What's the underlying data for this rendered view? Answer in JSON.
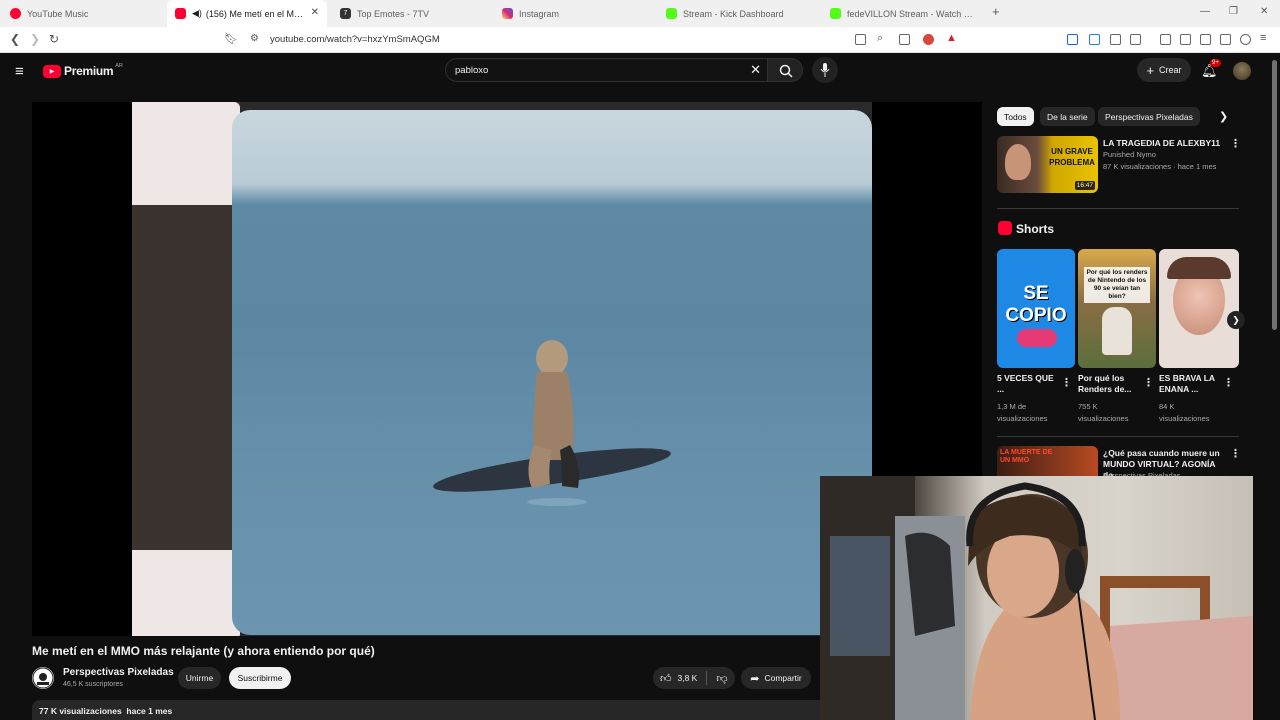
{
  "browser": {
    "tabs": [
      {
        "title": "YouTube Music",
        "color": "#ff0033"
      },
      {
        "title": "(156) Me metí en el MMO más relajante (y ahora entiendo por qué)",
        "color": "#ff0033",
        "active": true
      },
      {
        "title": "Top Emotes - 7TV",
        "color": "#29b6f6"
      },
      {
        "title": "Instagram",
        "color": "#d62976"
      },
      {
        "title": "Stream - Kick Dashboard",
        "color": "#53fc18"
      },
      {
        "title": "fedeVILLON Stream - Watch Live on Kick",
        "color": "#53fc18"
      }
    ],
    "url": "youtube.com/watch?v=hxzYmSmAQGM"
  },
  "header": {
    "logo": "Premium",
    "logo_badge": "AR",
    "search_value": "pabloxo",
    "create_label": "Crear",
    "notif_count": "9+"
  },
  "video": {
    "title": "Me metí en el MMO más relajante (y ahora entiendo por qué)",
    "channel": "Perspectivas Pixeladas",
    "subscribers": "46,5 K suscriptores",
    "join_label": "Unirme",
    "subscribe_label": "Suscribirme",
    "likes": "3,8 K",
    "share_label": "Compartir",
    "stats": "77 K visualizaciones  hace 1 mes"
  },
  "sidebar": {
    "chips": [
      "Todos",
      "De la serie",
      "Perspectivas Pixeladas"
    ],
    "recommended": [
      {
        "title": "LA TRAGEDIA DE ALEXBY11",
        "channel": "Punished Nymo",
        "meta": "87 K visualizaciones · hace 1 mes",
        "duration": "16:47",
        "thumb_text": "UN GRAVE PROBLEMA"
      },
      {
        "title": "¿Qué pasa cuando muere un MUNDO VIRTUAL? AGONÍA de...",
        "channel": "Perspectivas Pixeladas",
        "thumb_text": "LA MUERTE DE UN MMO"
      }
    ],
    "shorts_label": "Shorts",
    "shorts": [
      {
        "title": "5 VECES QUE ...",
        "views": "1,3 M de visualizaciones",
        "thumb_text": "SE COPIO",
        "bg": "#1e88e5"
      },
      {
        "title": "Por qué los Renders de...",
        "views": "755 K visualizaciones",
        "thumb_text": "Por qué los renders de Nintendo de los 90 se veían tan bien?",
        "bg": "#6b5a3a"
      },
      {
        "title": "ES BRAVA LA ENANA ...",
        "views": "84 K visualizaciones",
        "thumb_text": "",
        "bg": "#e8c9c0"
      }
    ]
  }
}
